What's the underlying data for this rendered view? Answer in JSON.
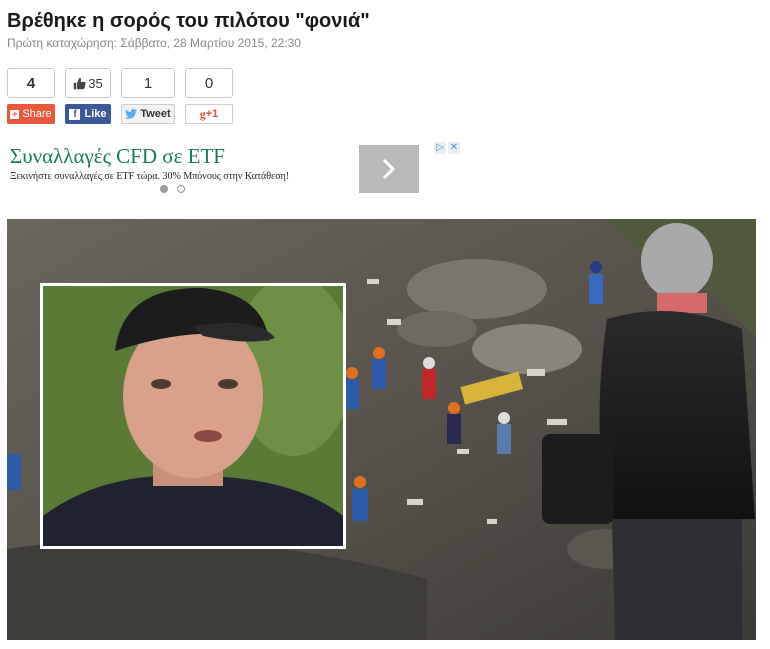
{
  "article": {
    "title": "Βρέθηκε η σορός του πιλότου \"φονιά\"",
    "meta": "Πρώτη καταχώρηση: Σάββατο, 28 Μαρτίου 2015, 22:30"
  },
  "social": {
    "total_count": "4",
    "like_count": "35",
    "tweet_count": "1",
    "gplus_count": "0",
    "share_label": "Share",
    "like_label": "Like",
    "tweet_label": "Tweet",
    "gplus_label": "+1"
  },
  "ad": {
    "title": "Συναλλαγές CFD σε ETF",
    "description": "Ξεκινήστε συναλλαγές σε ETF τώρα. 30% Μπόνους στην Κατάθεση!",
    "next_icon": "chevron-right-icon",
    "adchoices_icon": "adchoices-icon",
    "close_icon": "close-icon",
    "slides": 2,
    "active_slide": 1
  },
  "image": {
    "description_icon": "article-photo"
  }
}
